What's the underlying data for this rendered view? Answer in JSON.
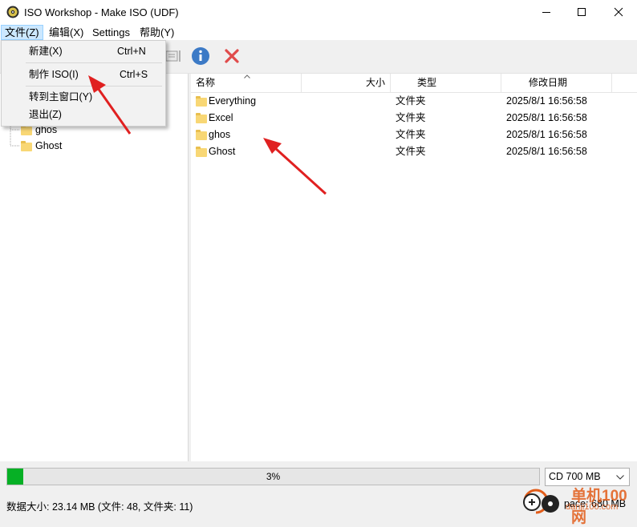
{
  "window": {
    "title": "ISO Workshop - Make ISO (UDF)",
    "icons": {
      "app": "disc-app-icon",
      "minimize": "minimize-icon",
      "maximize": "maximize-icon",
      "close": "close-icon"
    }
  },
  "menubar": {
    "items": [
      {
        "label": "文件(Z)"
      },
      {
        "label": "编辑(X)"
      },
      {
        "label": "Settings"
      },
      {
        "label": "帮助(Y)"
      }
    ]
  },
  "file_menu": {
    "items": [
      {
        "label": "新建(X)",
        "shortcut": "Ctrl+N"
      },
      {
        "label": "制作 ISO(I)",
        "shortcut": "Ctrl+S"
      },
      {
        "label": "转到主窗口(Y)",
        "shortcut": ""
      },
      {
        "label": "退出(Z)",
        "shortcut": ""
      }
    ]
  },
  "toolbar": {
    "icons": [
      "properties-icon",
      "info-icon",
      "delete-icon"
    ],
    "colors": {
      "info": "#3c7ac6",
      "delete": "#e04b4b"
    }
  },
  "tree": {
    "items": [
      {
        "label": "ghos"
      },
      {
        "label": "Ghost"
      }
    ]
  },
  "list": {
    "columns": {
      "name": "名称",
      "size": "大小",
      "type": "类型",
      "modified": "修改日期"
    },
    "rows": [
      {
        "name": "Everything",
        "size": "",
        "type": "文件夹",
        "modified": "2025/8/1 16:56:58"
      },
      {
        "name": "Excel",
        "size": "",
        "type": "文件夹",
        "modified": "2025/8/1 16:56:58"
      },
      {
        "name": "ghos",
        "size": "",
        "type": "文件夹",
        "modified": "2025/8/1 16:56:58"
      },
      {
        "name": "Ghost",
        "size": "",
        "type": "文件夹",
        "modified": "2025/8/1 16:56:58"
      }
    ]
  },
  "progress": {
    "value": 0.03,
    "label": "3%",
    "color": "#06b025"
  },
  "media": {
    "selected": "CD 700 MB"
  },
  "status": {
    "left": "数据大小: 23.14 MB (文件: 48, 文件夹: 11)",
    "right": "pace: 680 MB"
  },
  "watermark": {
    "text": "单机100网",
    "url": "danji100.com"
  },
  "annotations": {
    "arrow_color": "#e02020"
  }
}
